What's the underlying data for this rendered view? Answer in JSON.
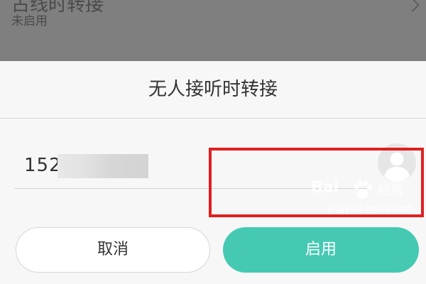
{
  "background": {
    "item_title": "占线时转接",
    "item_subtitle": "未启用",
    "chevron_icon": "chevron-right-icon"
  },
  "dialog": {
    "title": "无人接听时转接",
    "number_value": "152",
    "contact_icon": "contact-avatar-icon",
    "cancel_label": "取消",
    "enable_label": "启用"
  },
  "watermark": {
    "logo": "Bai",
    "text": "经验",
    "url": "jingyan.baidu.com"
  },
  "colors": {
    "accent": "#45c9b3",
    "highlight": "#e02020",
    "overlay": "#7f7f7f"
  }
}
